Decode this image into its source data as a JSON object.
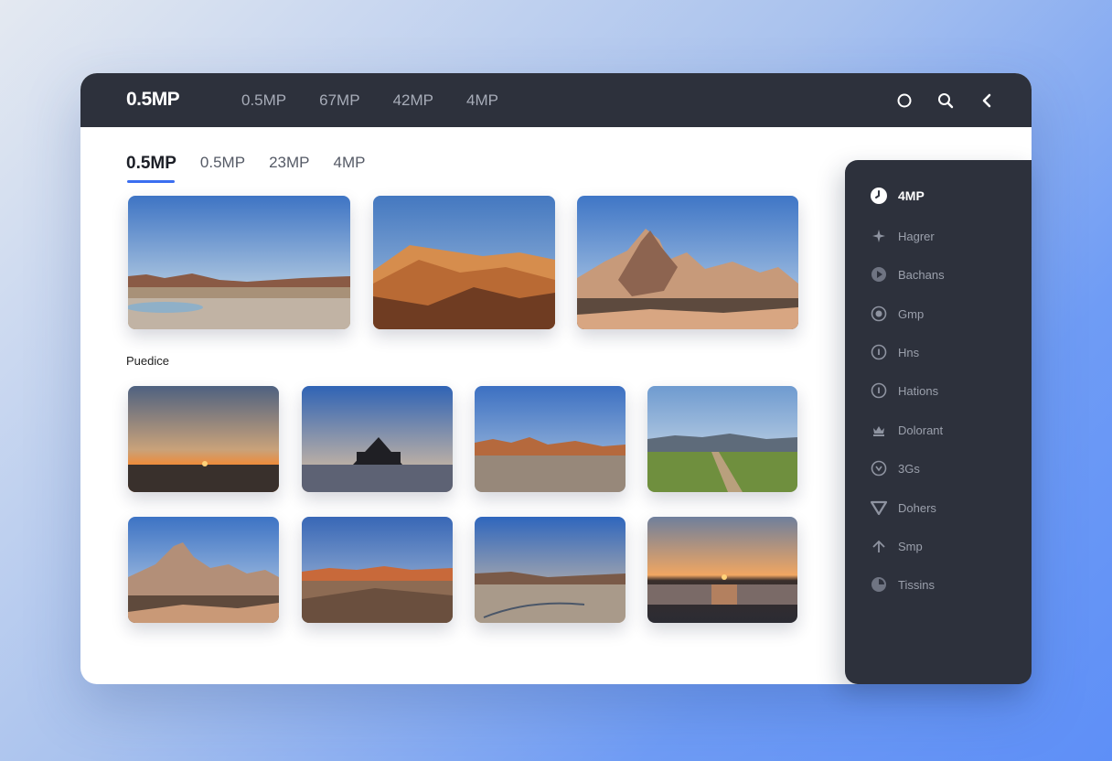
{
  "app": {
    "brand": "0.5MP",
    "top_nav": [
      "0.5MP",
      "67MP",
      "42MP",
      "4MP"
    ]
  },
  "top_icons": [
    "circle-icon",
    "search-icon",
    "back-chevron-icon"
  ],
  "tabs": [
    {
      "label": "0.5MP",
      "active": true
    },
    {
      "label": "0.5MP",
      "active": false
    },
    {
      "label": "23MP",
      "active": false
    },
    {
      "label": "4MP",
      "active": false
    }
  ],
  "section_label": "Puedice",
  "featured_photos": [
    "desert horizon at dusk",
    "orange sand dunes",
    "rocky mountain at golden hour"
  ],
  "gallery_photos": [
    "sunset over flat plain",
    "domed pavilion silhouette",
    "desert ridge at dusk",
    "grassland path",
    "rocky mountain",
    "red ridge plain",
    "dusk plain with tracks",
    "lake sunset reflection"
  ],
  "sidebar": {
    "items": [
      {
        "label": "4MP",
        "icon": "clock-icon",
        "active": true
      },
      {
        "label": "Hagrer",
        "icon": "sparkle-icon",
        "active": false
      },
      {
        "label": "Bachans",
        "icon": "play-circle-icon",
        "active": false
      },
      {
        "label": "Gmp",
        "icon": "target-icon",
        "active": false
      },
      {
        "label": "Hns",
        "icon": "info-circle-icon",
        "active": false
      },
      {
        "label": "Hations",
        "icon": "info-circle-icon",
        "active": false
      },
      {
        "label": "Dolorant",
        "icon": "crown-icon",
        "active": false
      },
      {
        "label": "3Gs",
        "icon": "badge-icon",
        "active": false
      },
      {
        "label": "Dohers",
        "icon": "triangle-down-icon",
        "active": false
      },
      {
        "label": "Smp",
        "icon": "arrow-up-icon",
        "active": false
      },
      {
        "label": "Tissins",
        "icon": "dial-icon",
        "active": false
      }
    ]
  }
}
